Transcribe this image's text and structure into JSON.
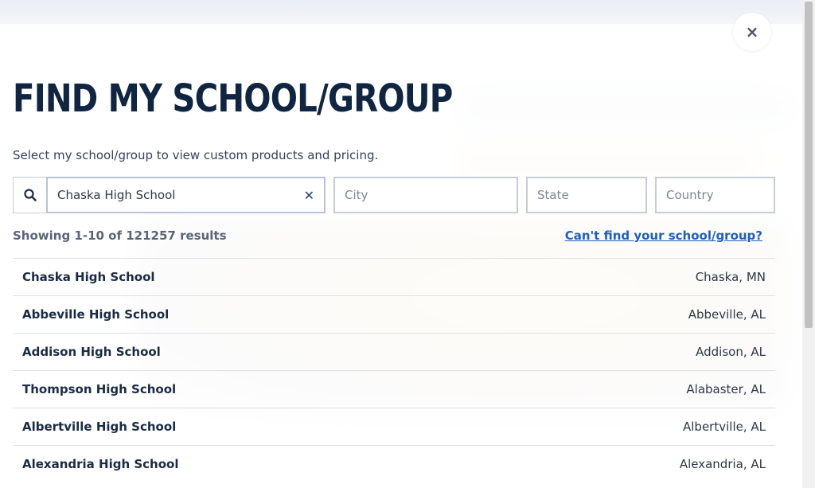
{
  "modal": {
    "title": "FIND MY SCHOOL/GROUP",
    "subtitle": "Select my school/group to view custom products and pricing.",
    "close_label": "×"
  },
  "search": {
    "value": "Chaska High School",
    "city_placeholder": "City",
    "state_placeholder": "State",
    "country_placeholder": "Country",
    "clear_label": "✕",
    "search_icon": "search-icon"
  },
  "results_info": "Showing 1-10 of 121257 results",
  "cant_find_link": "Can't find your school/group?",
  "results": [
    {
      "name": "Chaska High School",
      "location": "Chaska, MN"
    },
    {
      "name": "Abbeville High School",
      "location": "Abbeville, AL"
    },
    {
      "name": "Addison High School",
      "location": "Addison, AL"
    },
    {
      "name": "Thompson High School",
      "location": "Alabaster, AL"
    },
    {
      "name": "Albertville High School",
      "location": "Albertville, AL"
    },
    {
      "name": "Alexandria High School",
      "location": "Alexandria, AL"
    }
  ],
  "colors": {
    "title": "#0f2541",
    "link": "#1f5fbf",
    "accent": "#1d3e73"
  }
}
